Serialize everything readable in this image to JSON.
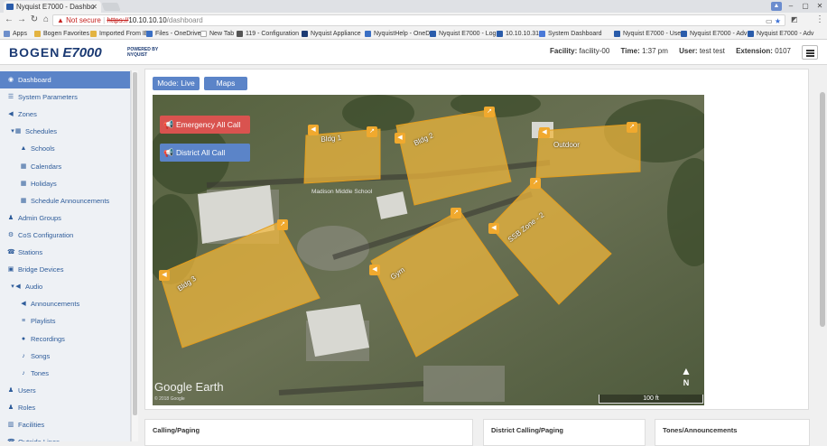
{
  "browser": {
    "tab_title": "Nyquist E7000 - Dashbo",
    "url_warning": "Not secure",
    "url_scheme": "https://",
    "url_host": "10.10.10.10",
    "url_path": "/dashboard",
    "bookmarks": [
      "Apps",
      "Bogen Favorites",
      "Imported From IE",
      "Files - OneDrive",
      "New Tab",
      "119 - Configuration",
      "Nyquist Appliance",
      "NyquistHelp - OneD",
      "Nyquist E7000 - Log",
      "10.10.10.31",
      "System Dashboard",
      "Nyquist E7000 - Use",
      "Nyquist E7000 - Adv",
      "Nyquist E7000 - Adv"
    ]
  },
  "header": {
    "logo_main": "BOGEN",
    "logo_product": "E7000",
    "logo_tag": "POWERED BY NYQUIST",
    "facility_label": "Facility:",
    "facility_value": "facility-00",
    "time_label": "Time:",
    "time_value": "1:37 pm",
    "user_label": "User:",
    "user_value": "test test",
    "extension_label": "Extension:",
    "extension_value": "0107"
  },
  "sidebar": {
    "items": [
      {
        "label": "Dashboard",
        "icon": "dashboard-icon",
        "level": 0,
        "active": true
      },
      {
        "label": "System Parameters",
        "icon": "sliders-icon",
        "level": 0
      },
      {
        "label": "Zones",
        "icon": "megaphone-icon",
        "level": 0
      },
      {
        "label": "Schedules",
        "icon": "calendar-icon",
        "level": 0,
        "expanded": true
      },
      {
        "label": "Schools",
        "icon": "graduation-cap-icon",
        "level": 1
      },
      {
        "label": "Calendars",
        "icon": "calendar-icon",
        "level": 1
      },
      {
        "label": "Holidays",
        "icon": "calendar-icon",
        "level": 1
      },
      {
        "label": "Schedule Announcements",
        "icon": "calendar-icon",
        "level": 1
      },
      {
        "label": "Admin Groups",
        "icon": "users-icon",
        "level": 0
      },
      {
        "label": "CoS Configuration",
        "icon": "cogs-icon",
        "level": 0
      },
      {
        "label": "Stations",
        "icon": "phone-icon",
        "level": 0
      },
      {
        "label": "Bridge Devices",
        "icon": "sitemap-icon",
        "level": 0
      },
      {
        "label": "Audio",
        "icon": "volume-icon",
        "level": 0,
        "expanded": true
      },
      {
        "label": "Announcements",
        "icon": "volume-icon",
        "level": 1
      },
      {
        "label": "Playlists",
        "icon": "list-icon",
        "level": 1
      },
      {
        "label": "Recordings",
        "icon": "microphone-icon",
        "level": 1
      },
      {
        "label": "Songs",
        "icon": "music-icon",
        "level": 1
      },
      {
        "label": "Tones",
        "icon": "music-icon",
        "level": 1
      },
      {
        "label": "Users",
        "icon": "user-icon",
        "level": 0
      },
      {
        "label": "Roles",
        "icon": "users-icon",
        "level": 0
      },
      {
        "label": "Facilities",
        "icon": "building-icon",
        "level": 0
      },
      {
        "label": "Outside Lines",
        "icon": "phone-icon",
        "level": 0
      }
    ]
  },
  "main": {
    "mode_button": "Mode: Live",
    "maps_button": "Maps",
    "emergency_call": "Emergency All Call",
    "district_call": "District All Call",
    "zones": [
      {
        "label": "Bldg 1"
      },
      {
        "label": "Bldg 2"
      },
      {
        "label": "Outdoor"
      },
      {
        "label": "Bldg 3"
      },
      {
        "label": "Gym"
      },
      {
        "label": "SSB Zone - 2"
      }
    ],
    "map_watermark": "Google Earth",
    "map_copyright": "© 2018 Google",
    "map_place": "Madison Middle School",
    "scale_label": "100 ft",
    "north_label": "N",
    "cards": [
      "Calling/Paging",
      "District Calling/Paging",
      "Tones/Announcements"
    ]
  },
  "colors": {
    "accent": "#5b84c8",
    "emergency": "#d9534f",
    "zone_fill": "#f2b83c",
    "zone_badge": "#f0a92e",
    "brand": "#1b3a73"
  }
}
